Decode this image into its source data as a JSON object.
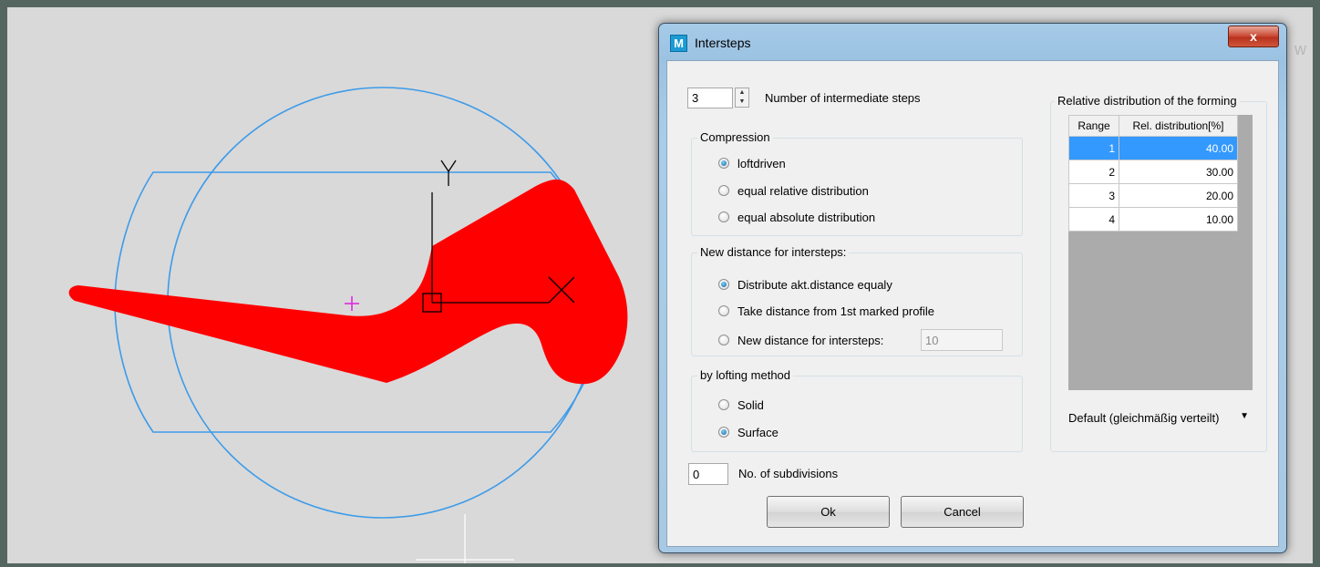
{
  "background_letter": "w",
  "dialog": {
    "title": "Intersteps",
    "close_label": "x",
    "app_icon_letter": "M"
  },
  "steps": {
    "value": "3",
    "label": "Number of intermediate steps"
  },
  "compression": {
    "title": "Compression",
    "options": [
      "loftdriven",
      "equal relative distribution",
      "equal absolute distribution"
    ],
    "selected": 0
  },
  "new_distance": {
    "title": "New distance for intersteps:",
    "options": [
      "Distribute akt.distance equaly",
      "Take distance from 1st marked profile",
      "New distance for intersteps:"
    ],
    "selected": 0,
    "value": "10"
  },
  "lofting": {
    "title": "by lofting method",
    "options": [
      "Solid",
      "Surface"
    ],
    "selected": 1
  },
  "subdivisions": {
    "value": "0",
    "label": "No. of subdivisions"
  },
  "buttons": {
    "ok": "Ok",
    "cancel": "Cancel"
  },
  "distribution": {
    "title": "Relative distribution of the forming",
    "headers": [
      "Range",
      "Rel. distribution[%]"
    ],
    "rows": [
      {
        "range": "1",
        "value": "40.00"
      },
      {
        "range": "2",
        "value": "30.00"
      },
      {
        "range": "3",
        "value": "20.00"
      },
      {
        "range": "4",
        "value": "10.00"
      }
    ],
    "selected_row": 0,
    "preset": "Default (gleichmäßig verteilt)"
  },
  "cad": {
    "axis_y": "Y",
    "colors": {
      "profile": "#ff0000",
      "circle": "#3d9be9",
      "marker": "#e020e0"
    }
  }
}
